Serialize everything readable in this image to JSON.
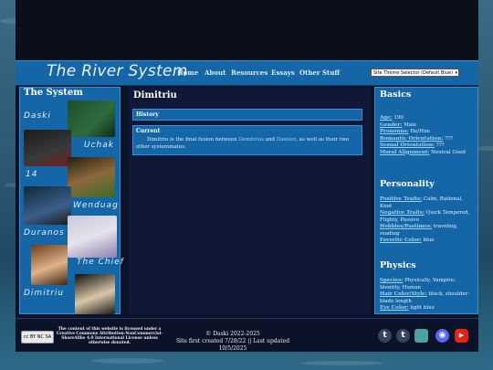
{
  "header": {
    "site_title": "The River System",
    "nav": [
      "Home",
      "About",
      "Resources",
      "Essays",
      "Other Stuff"
    ],
    "theme_selector": "Site Theme Selector (Default Blue)"
  },
  "sidebar": {
    "title": "The System",
    "members": [
      "Daski",
      "Uchak",
      "14",
      "Wenduag",
      "Duranos",
      "The Chief",
      "Dimitriu"
    ]
  },
  "main": {
    "page_title": "Dimitriu",
    "history_label": "History",
    "current_label": "Current",
    "current_text_before": "Dimitriu is the final fusion between",
    "link1": "Demitrius",
    "and_text": "and",
    "link2": "Damien",
    "current_text_after": ", as well as their two other systemmates."
  },
  "info": {
    "basics_title": "Basics",
    "age_label": "Age:",
    "age": "190",
    "gender_label": "Gender:",
    "gender": "Male",
    "pronouns_label": "Pronouns:",
    "pronouns": "He/Him",
    "romantic_label": "Romantic Orientation:",
    "romantic": "???",
    "sexual_label": "Sexual Orientation:",
    "sexual": "???",
    "moral_label": "Moral Alignment:",
    "moral": "Neutral Good",
    "personality_title": "Personality",
    "pos_label": "Positive Traits:",
    "pos": "Calm, Rational, Kind",
    "neg_label": "Negative Traits:",
    "neg": "Quick Tempered, Flighty, Passive",
    "hobbies_label": "Hobbies/Pastimes:",
    "hobbies": "traveling, reading",
    "color_label": "Favorite Color:",
    "color": "blue",
    "physics_title": "Physics",
    "species_label": "Species:",
    "species": "Physically, Vampire; Identity, Human",
    "hair_label": "Hair Color/Style:",
    "hair": "black, shoulder-blade length",
    "eye_label": "Eye Color:",
    "eye": "light blue"
  },
  "footer": {
    "cc_badge": "cc BY NC SA",
    "license": "The content of this website is licensed under a Creative Commons Attribution-NonCommercial-ShareAlike 4.0 International License unless otherwise denoted.",
    "copyright": "© Daski 2022-2025",
    "updated": "Site first created 7/28/22 || Last updated 10/5/2025",
    "social": [
      {
        "icon": "tumblr-icon",
        "glyph": "t",
        "color": "#35465c"
      },
      {
        "icon": "tumblr-icon",
        "glyph": "t",
        "color": "#35465c"
      },
      {
        "icon": "toyhouse-icon",
        "glyph": "",
        "color": "#4aa3a0"
      },
      {
        "icon": "discord-icon",
        "glyph": "◉",
        "color": "#5865f2"
      },
      {
        "icon": "youtube-icon",
        "glyph": "▶",
        "color": "#e62117"
      }
    ]
  }
}
